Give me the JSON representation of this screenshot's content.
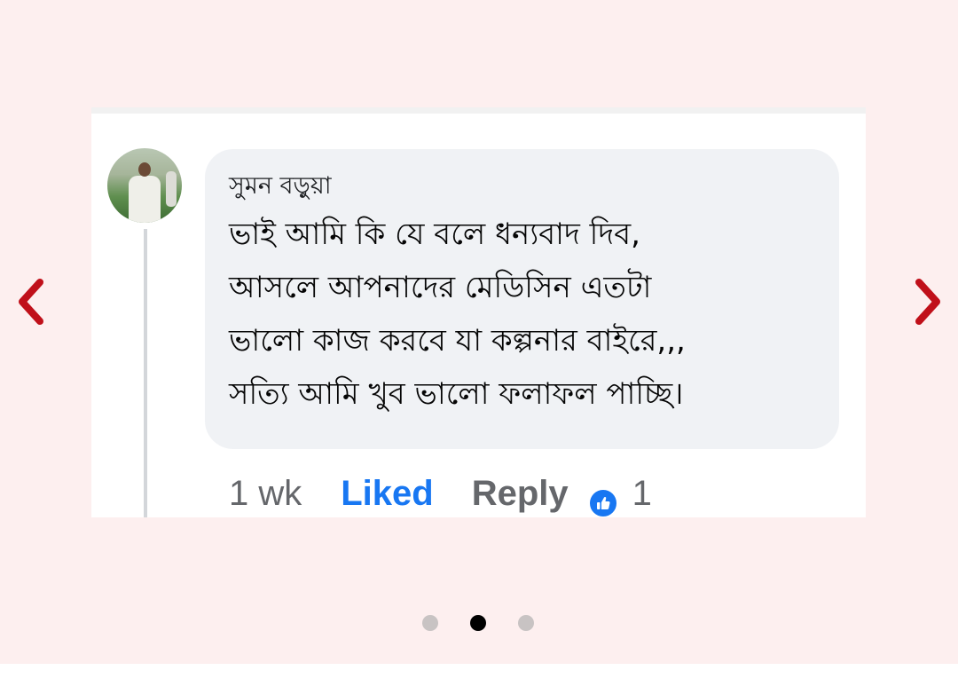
{
  "carousel": {
    "prev_icon": "chevron-left-icon",
    "next_icon": "chevron-right-icon",
    "arrow_color": "#c0101a",
    "slide_count": 3,
    "active_slide": 2
  },
  "comment": {
    "author": "সুমন বড়ুয়া",
    "lines": [
      "ভাই আমি কি যে বলে ধন্যবাদ দিব,",
      "আসলে আপনাদের মেডিসিন এতটা",
      "ভালো কাজ করবে যা কল্পনার বাইরে,,,",
      "সত্যি আমি খুব ভালো ফলাফল পাচ্ছি।"
    ],
    "time": "1 wk",
    "liked_label": "Liked",
    "reply_label": "Reply",
    "like_count": "1",
    "like_color": "#1877f2"
  }
}
